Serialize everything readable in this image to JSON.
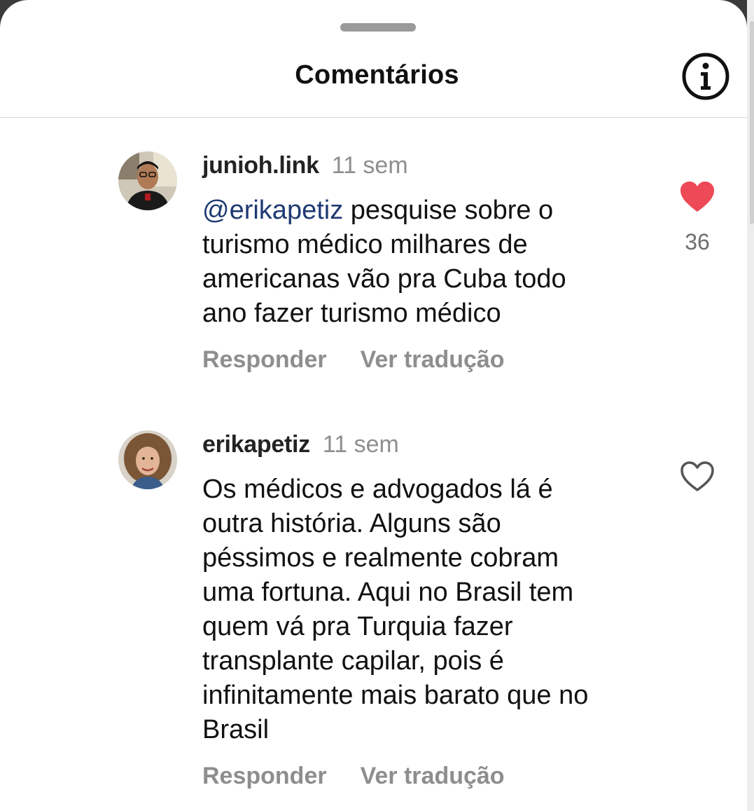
{
  "sheet": {
    "title": "Comentários"
  },
  "colors": {
    "like_active": "#ed4956",
    "mention": "#1f3a73",
    "muted_text": "#8e8e8e"
  },
  "comments": [
    {
      "username": "junioh.link",
      "time": "11 sem",
      "mention": "@erikapetiz",
      "text": " pesquise sobre o\nturismo médico milhares de\namericanas vão pra Cuba todo\nano fazer turismo médico",
      "reply_label": "Responder",
      "translate_label": "Ver tradução",
      "liked": true,
      "like_count": "36"
    },
    {
      "username": "erikapetiz",
      "time": "11 sem",
      "text": "Os médicos e advogados lá é\noutra história. Alguns são\npéssimos e realmente cobram\numa fortuna. Aqui no Brasil tem\nquem vá pra Turquia fazer\ntransplante capilar, pois é\ninfinitamente mais  barato que no\nBrasil",
      "reply_label": "Responder",
      "translate_label": "Ver tradução",
      "liked": false
    }
  ]
}
